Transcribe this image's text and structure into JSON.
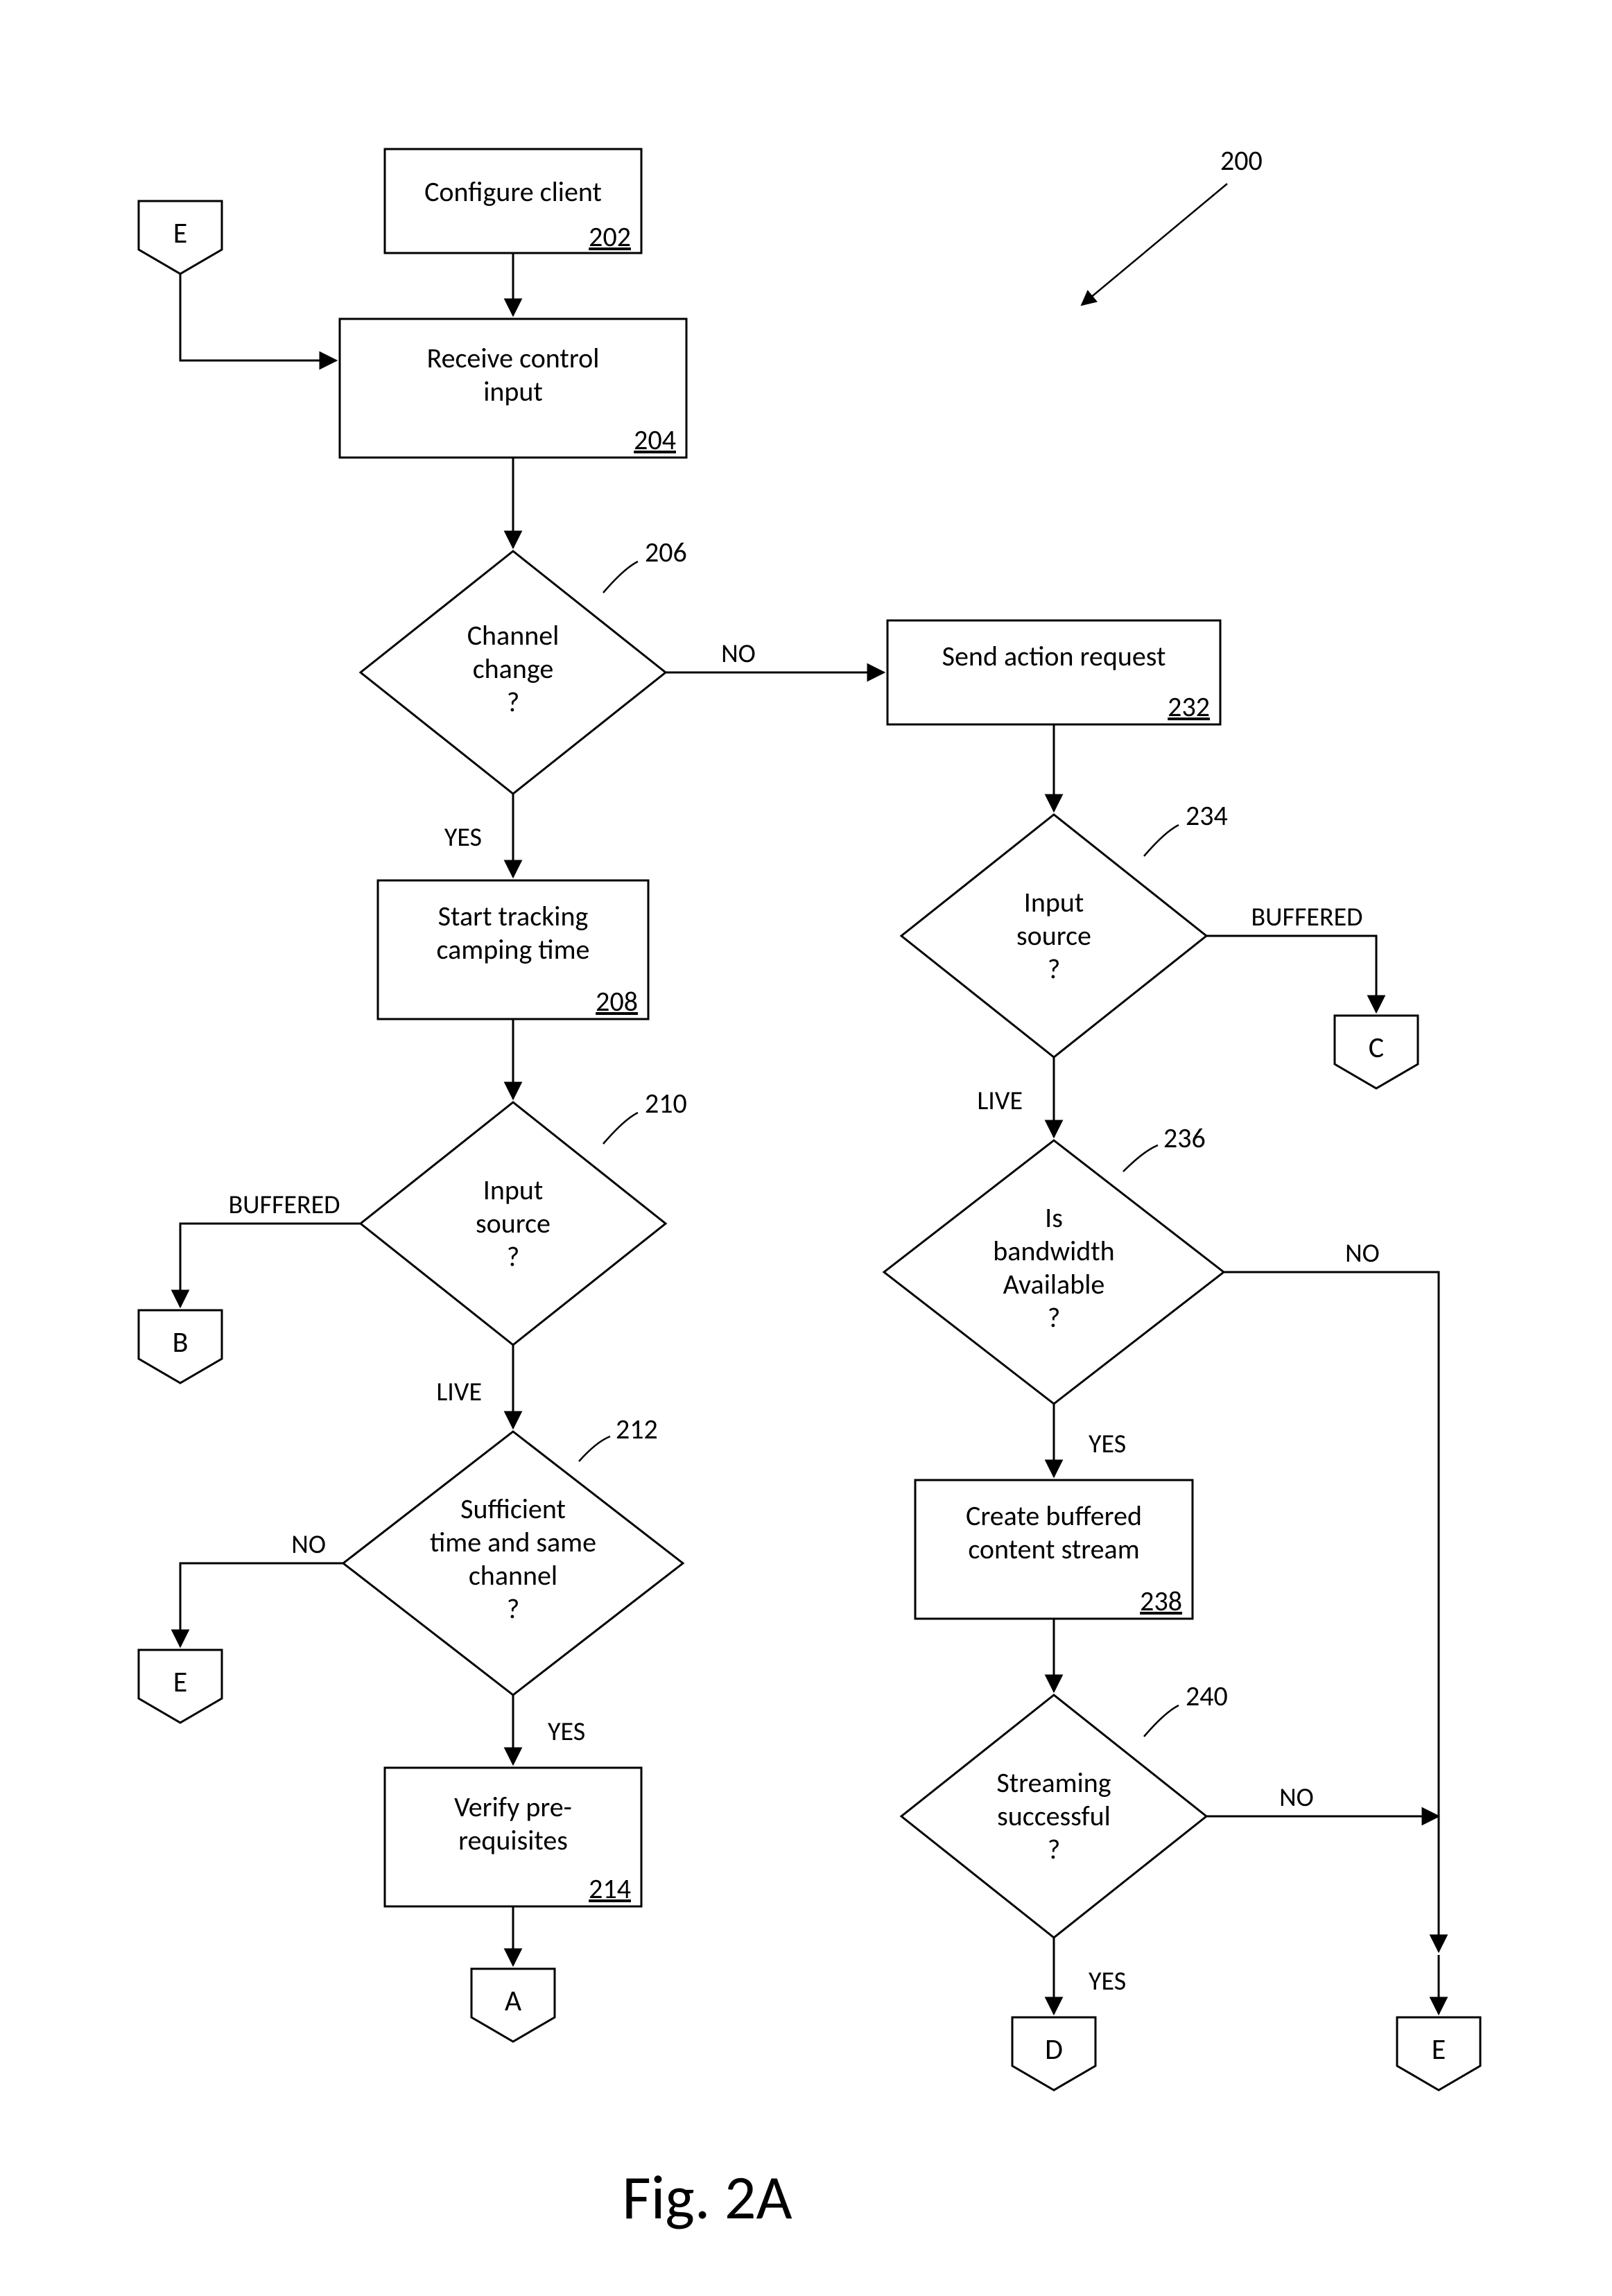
{
  "figure_caption": "Fig. 2A",
  "figure_ref_annotation": "200",
  "nodes": {
    "n202": {
      "text": "Configure client",
      "ref": "202"
    },
    "n204": {
      "text1": "Receive control",
      "text2": "input",
      "ref": "204"
    },
    "n206": {
      "text1": "Channel",
      "text2": "change",
      "text3": "?",
      "ref": "206"
    },
    "n208": {
      "text1": "Start tracking",
      "text2": "camping time",
      "ref": "208"
    },
    "n210": {
      "text1": "Input",
      "text2": "source",
      "text3": "?",
      "ref": "210"
    },
    "n212": {
      "text1": "Sufficient",
      "text2": "time and same",
      "text3": "channel",
      "text4": "?",
      "ref": "212"
    },
    "n214": {
      "text1": "Verify pre-",
      "text2": "requisites",
      "ref": "214"
    },
    "n232": {
      "text": "Send action request",
      "ref": "232"
    },
    "n234": {
      "text1": "Input",
      "text2": "source",
      "text3": "?",
      "ref": "234"
    },
    "n236": {
      "text1": "Is",
      "text2": "bandwidth",
      "text3": "Available",
      "text4": "?",
      "ref": "236"
    },
    "n238": {
      "text1": "Create buffered",
      "text2": "content stream",
      "ref": "238"
    },
    "n240": {
      "text1": "Streaming",
      "text2": "successful",
      "text3": "?",
      "ref": "240"
    }
  },
  "connectors": {
    "eTop": "E",
    "b210": "B",
    "e212": "E",
    "a214": "A",
    "c234": "C",
    "d240": "D",
    "e_right": "E"
  },
  "edge_labels": {
    "l206_no": "NO",
    "l206_yes": "YES",
    "l210_buffered": "BUFFERED",
    "l210_live": "LIVE",
    "l212_no": "NO",
    "l212_yes": "YES",
    "l234_buffered": "BUFFERED",
    "l234_live": "LIVE",
    "l236_no": "NO",
    "l236_yes": "YES",
    "l240_no": "NO",
    "l240_yes": "YES"
  }
}
